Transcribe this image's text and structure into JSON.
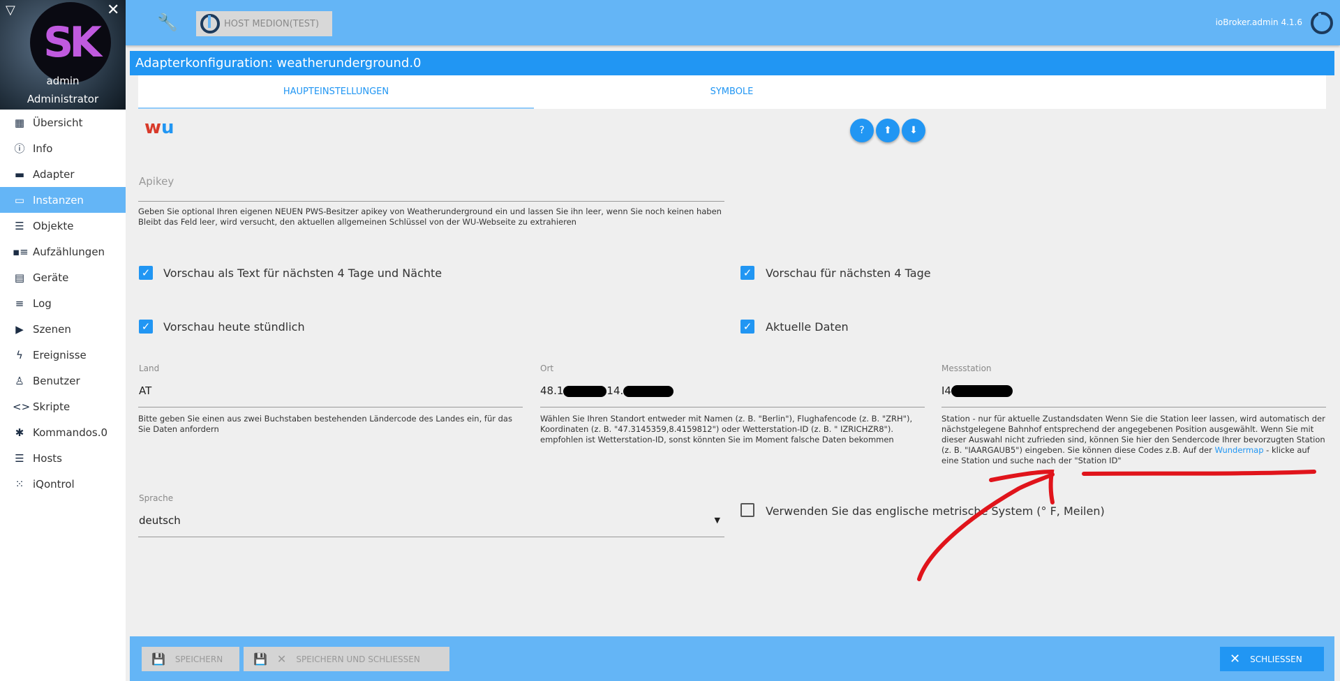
{
  "sidebar": {
    "user": "admin",
    "role": "Administrator",
    "items": [
      {
        "label": "Übersicht",
        "icon": "apps-icon"
      },
      {
        "label": "Info",
        "icon": "info-icon"
      },
      {
        "label": "Adapter",
        "icon": "store-icon"
      },
      {
        "label": "Instanzen",
        "icon": "instances-icon",
        "active": true
      },
      {
        "label": "Objekte",
        "icon": "list-icon"
      },
      {
        "label": "Aufzählungen",
        "icon": "enum-icon"
      },
      {
        "label": "Geräte",
        "icon": "devices-icon"
      },
      {
        "label": "Log",
        "icon": "log-icon"
      },
      {
        "label": "Szenen",
        "icon": "scenes-icon"
      },
      {
        "label": "Ereignisse",
        "icon": "flash-icon"
      },
      {
        "label": "Benutzer",
        "icon": "user-icon"
      },
      {
        "label": "Skripte",
        "icon": "code-icon"
      },
      {
        "label": "Kommandos.0",
        "icon": "snowflake-icon"
      },
      {
        "label": "Hosts",
        "icon": "hosts-icon"
      },
      {
        "label": "iQontrol",
        "icon": "dots-icon"
      }
    ]
  },
  "header": {
    "host": "HOST MEDION(TEST)",
    "version": "ioBroker.admin 4.1.6"
  },
  "dialog": {
    "title": "Adapterkonfiguration: weatherunderground.0",
    "tabs": [
      "HAUPTEINSTELLUNGEN",
      "SYMBOLE"
    ],
    "apikey": {
      "label": "Apikey",
      "value": "",
      "help": "Geben Sie optional Ihren eigenen NEUEN PWS-Besitzer apikey von Weatherunderground ein und lassen Sie ihn leer, wenn Sie noch keinen haben Bleibt das Feld leer, wird versucht, den aktuellen allgemeinen Schlüssel von der WU-Webseite zu extrahieren"
    },
    "checkboxes": [
      {
        "label": "Vorschau als Text für nächsten 4 Tage und Nächte",
        "checked": true
      },
      {
        "label": "Vorschau für nächsten 4 Tage",
        "checked": true
      },
      {
        "label": "Vorschau heute stündlich",
        "checked": true
      },
      {
        "label": "Aktuelle Daten",
        "checked": true
      }
    ],
    "land": {
      "label": "Land",
      "value": "AT",
      "help": "Bitte geben Sie einen aus zwei Buchstaben bestehenden Ländercode des Landes ein, für das Sie Daten anfordern"
    },
    "ort": {
      "label": "Ort",
      "value": "48.1",
      "value2": "14.",
      "help": "Wählen Sie Ihren Standort entweder mit Namen (z. B. \"Berlin\"), Flughafencode (z. B. \"ZRH\"), Koordinaten (z. B. \"47.3145359,8.4159812\") oder Wetterstation-ID (z. B. \" IZRICHZR8\"). empfohlen ist Wetterstation-ID, sonst könnten Sie im Moment falsche Daten bekommen"
    },
    "station": {
      "label": "Messstation",
      "value": "I4",
      "help_pre": "Station - nur für aktuelle Zustandsdaten Wenn Sie die Station leer lassen, wird automatisch der nächstgelegene Bahnhof entsprechend der angegebenen Position ausgewählt. Wenn Sie mit dieser Auswahl nicht zufrieden sind, können Sie hier den Sendercode Ihrer bevorzugten Station (z. B. \"IAARGAUB5\") eingeben. Sie können diese Codes z.B. Auf der ",
      "link": "Wundermap",
      "help_post": " - klicke auf eine Station und suche nach der \"Station ID\""
    },
    "sprache": {
      "label": "Sprache",
      "value": "deutsch"
    },
    "metric": {
      "label": "Verwenden Sie das englische metrische System (° F, Meilen)",
      "checked": false
    }
  },
  "footer": {
    "save": "SPEICHERN",
    "save_close": "SPEICHERN UND SCHLIESSEN",
    "close": "SCHLIESSEN"
  },
  "annotation_color": "#e0141b"
}
